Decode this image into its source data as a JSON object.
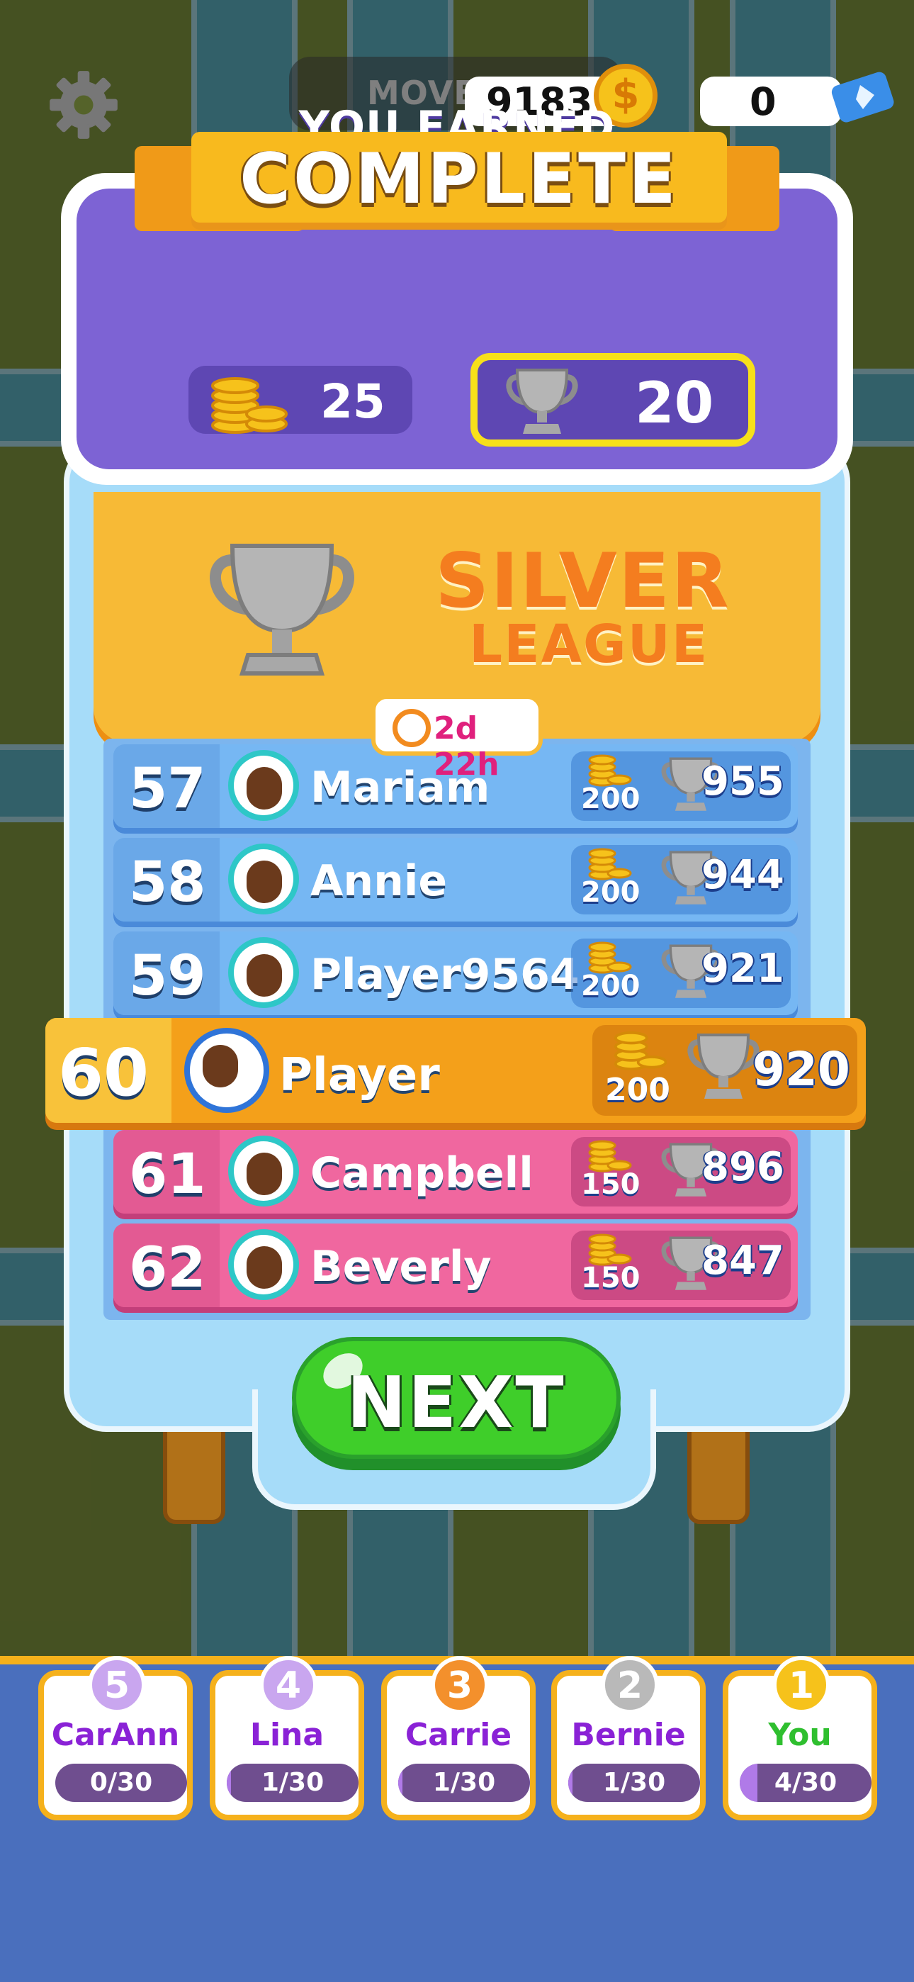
{
  "hud": {
    "moves_label": "MOVE",
    "coins": "9183",
    "coin_symbol": "$",
    "tickets": "0"
  },
  "banner": {
    "title": "COMPLETE"
  },
  "earned": {
    "title": "YOU EARNED",
    "coins": "25",
    "trophies": "20"
  },
  "league": {
    "line1": "SILVER",
    "line2": "LEAGUE",
    "timer": "2d 22h"
  },
  "leaderboard": [
    {
      "rank": "57",
      "name": "Mariam",
      "coins": "200",
      "trophies": "955",
      "tier": "blue"
    },
    {
      "rank": "58",
      "name": "Annie",
      "coins": "200",
      "trophies": "944",
      "tier": "blue"
    },
    {
      "rank": "59",
      "name": "Player9564",
      "coins": "200",
      "trophies": "921",
      "tier": "blue"
    },
    {
      "rank": "60",
      "name": "Player",
      "coins": "200",
      "trophies": "920",
      "tier": "player"
    },
    {
      "rank": "61",
      "name": "Campbell",
      "coins": "150",
      "trophies": "896",
      "tier": "pink"
    },
    {
      "rank": "62",
      "name": "Beverly",
      "coins": "150",
      "trophies": "847",
      "tier": "pink"
    }
  ],
  "next_button": {
    "label": "NEXT"
  },
  "race": [
    {
      "place": "5",
      "name": "CarAnn",
      "progress": "0/30",
      "fraction": 0.0,
      "badge_color": "#c9a6ef"
    },
    {
      "place": "4",
      "name": "Lina",
      "progress": "1/30",
      "fraction": 0.033,
      "badge_color": "#c9a6ef"
    },
    {
      "place": "3",
      "name": "Carrie",
      "progress": "1/30",
      "fraction": 0.033,
      "badge_color": "#f3902c"
    },
    {
      "place": "2",
      "name": "Bernie",
      "progress": "1/30",
      "fraction": 0.033,
      "badge_color": "#b9b9b9"
    },
    {
      "place": "1",
      "name": "You",
      "progress": "4/30",
      "fraction": 0.133,
      "badge_color": "#f6c21b",
      "name_color": "#2fbf2f"
    }
  ],
  "colors": {
    "accent_purple": "#7d63d4",
    "banner_yellow": "#f8ba1e",
    "next_green": "#3fce2a",
    "league_text": "#f47d1f"
  }
}
